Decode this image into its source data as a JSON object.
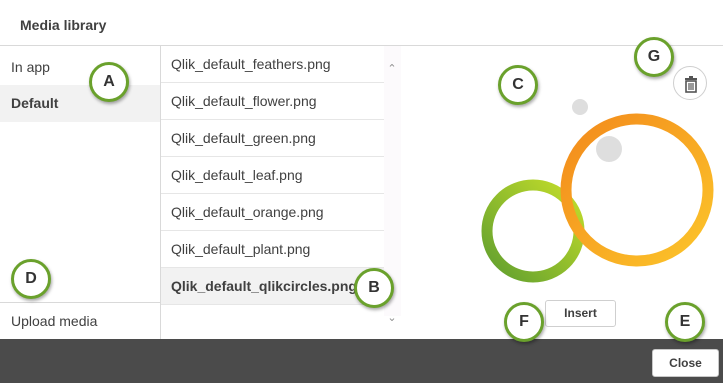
{
  "dialog": {
    "title": "Media library"
  },
  "sidebar": {
    "items": [
      {
        "label": "In app"
      },
      {
        "label": "Default"
      }
    ],
    "upload_label": "Upload media"
  },
  "files": [
    {
      "name": "Qlik_default_feathers.png"
    },
    {
      "name": "Qlik_default_flower.png"
    },
    {
      "name": "Qlik_default_green.png"
    },
    {
      "name": "Qlik_default_leaf.png"
    },
    {
      "name": "Qlik_default_orange.png"
    },
    {
      "name": "Qlik_default_plant.png"
    },
    {
      "name": "Qlik_default_qlikcircles.png"
    }
  ],
  "preview": {
    "insert_label": "Insert",
    "delete_icon": "trash-icon"
  },
  "footer": {
    "close_label": "Close"
  },
  "callouts": {
    "a": "A",
    "b": "B",
    "c": "C",
    "d": "D",
    "e": "E",
    "f": "F",
    "g": "G"
  },
  "colors": {
    "callout_border": "#6aa12c",
    "footer_bg": "#4b4b4b",
    "selected_bg": "#f2f2f2",
    "ring_green": "#8cc63f",
    "ring_orange": "#f7941d"
  }
}
